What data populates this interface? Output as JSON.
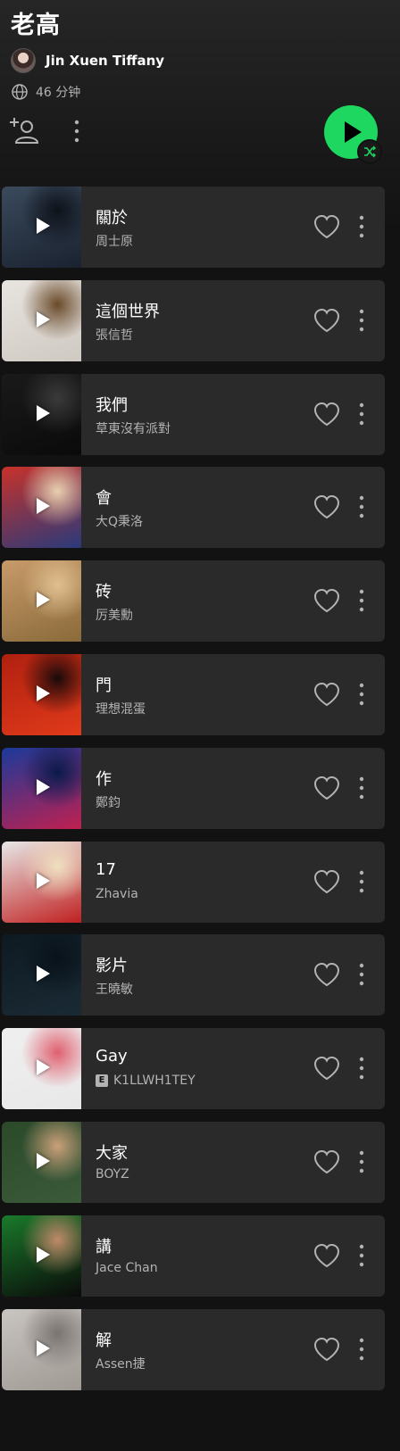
{
  "playlist": {
    "title": "老高",
    "owner": "Jin Xuen Tiffany",
    "duration": "46 分钟"
  },
  "icons": {
    "globe": "globe-icon",
    "add_user": "add-user-icon",
    "more": "more-vertical-icon",
    "play": "play-icon",
    "shuffle": "shuffle-icon",
    "heart": "heart-icon"
  },
  "colors": {
    "accent": "#1ed760",
    "row_bg": "#2a2a2a",
    "secondary_text": "#b3b3b3",
    "background": "#121212"
  },
  "tracks": [
    {
      "title": "關於",
      "artist": "周士原",
      "explicit": false,
      "cover": [
        "#3a4a5c",
        "#1a2230",
        "#0e121a"
      ]
    },
    {
      "title": "這個世界",
      "artist": "張信哲",
      "explicit": false,
      "cover": [
        "#e8e4df",
        "#cfc9c2",
        "#6a4a2a"
      ]
    },
    {
      "title": "我們",
      "artist": "草東沒有派對",
      "explicit": false,
      "cover": [
        "#1a1a1a",
        "#0a0a0a",
        "#3a3a3a"
      ]
    },
    {
      "title": "會",
      "artist": "大Q秉洛",
      "explicit": false,
      "cover": [
        "#c8322a",
        "#2a3a7a",
        "#e8d0b0"
      ]
    },
    {
      "title": "砖",
      "artist": "厉美勳",
      "explicit": false,
      "cover": [
        "#c89a6a",
        "#8a6a3a",
        "#e0c090"
      ]
    },
    {
      "title": "門",
      "artist": "理想混蛋",
      "explicit": false,
      "cover": [
        "#b02010",
        "#e03a1a",
        "#1a0a0a"
      ]
    },
    {
      "title": "作",
      "artist": "鄭鈞",
      "explicit": false,
      "cover": [
        "#1a3a9a",
        "#c02050",
        "#0a1a4a"
      ]
    },
    {
      "title": "17",
      "artist": "Zhavia",
      "explicit": false,
      "cover": [
        "#e8e8e8",
        "#c02020",
        "#f0e0c0"
      ]
    },
    {
      "title": "影片",
      "artist": "王曉敏",
      "explicit": false,
      "cover": [
        "#0e1a22",
        "#1a2a34",
        "#08121a"
      ]
    },
    {
      "title": "Gay",
      "artist": "K1LLWH1TEY",
      "explicit": true,
      "cover": [
        "#efefef",
        "#e8e8e8",
        "#e06070"
      ]
    },
    {
      "title": "大家",
      "artist": "BOYZ",
      "explicit": false,
      "cover": [
        "#2a4a2a",
        "#3a5a3a",
        "#caa07a"
      ]
    },
    {
      "title": "講",
      "artist": "Jace Chan",
      "explicit": false,
      "cover": [
        "#1a7a2a",
        "#0a0a0a",
        "#c08a6a"
      ]
    },
    {
      "title": "解",
      "artist": "Assen捷",
      "explicit": false,
      "cover": [
        "#c8c4c0",
        "#a09a94",
        "#7a7470"
      ]
    }
  ]
}
